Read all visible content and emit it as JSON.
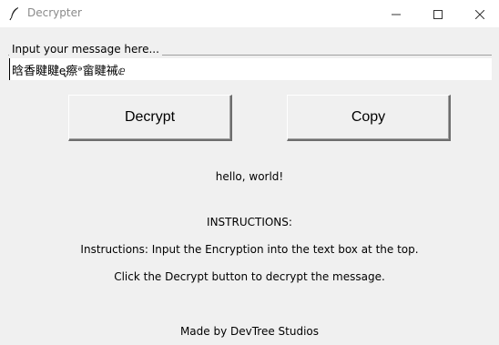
{
  "window": {
    "title": "Decrypter",
    "app_icon": "feather-icon",
    "controls": [
      "minimize-icon",
      "maximize-icon",
      "close-icon"
    ]
  },
  "input_frame": {
    "label": "Input your message here...",
    "value": "晗香睷睷ᶒ瘵ᵊ畲睷祴ⅇ"
  },
  "buttons": {
    "decrypt_label": "Decrypt",
    "copy_label": "Copy"
  },
  "output": {
    "text": "hello, world!"
  },
  "instructions": {
    "heading": "INSTRUCTIONS:",
    "line1": "Instructions: Input the Encryption into the text box at the top.",
    "line2": "Click the Decrypt button to decrypt the message."
  },
  "footer": {
    "credit": "Made by DevTree Studios"
  },
  "colors": {
    "window_bg": "#f0f0f0",
    "titlebar_bg": "#ffffff",
    "title_text": "#8a8a8a"
  }
}
